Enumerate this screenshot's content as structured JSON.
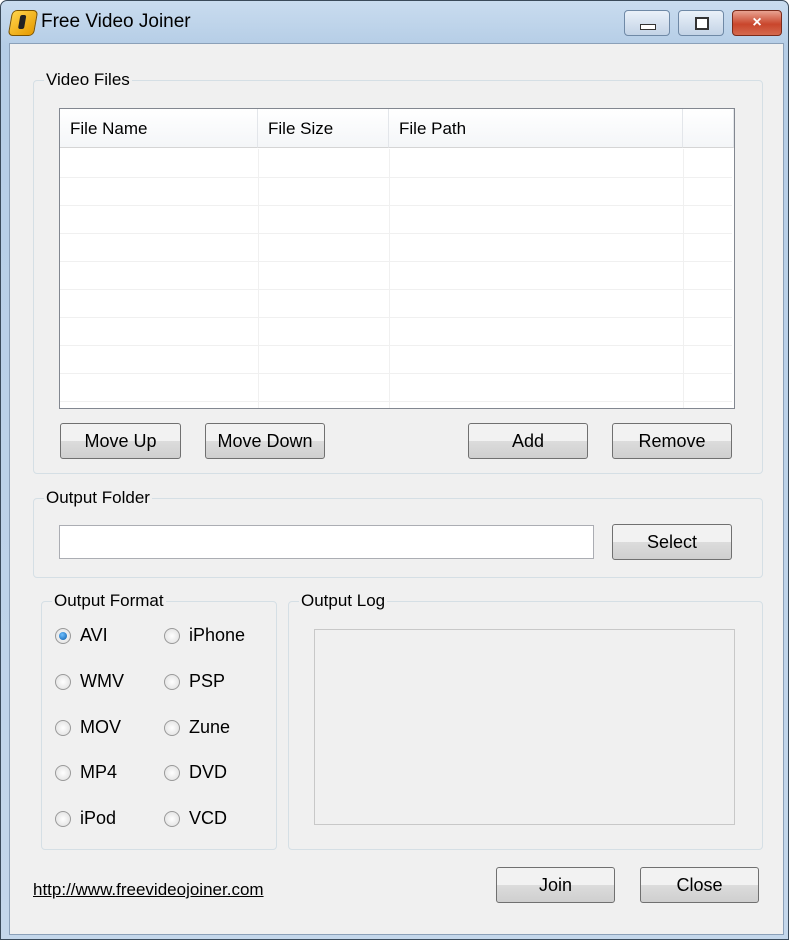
{
  "window": {
    "title": "Free Video Joiner",
    "controls": {
      "minimize": "minimize-icon",
      "maximize": "maximize-icon",
      "close": "×"
    }
  },
  "video_files": {
    "label": "Video Files",
    "columns": [
      "File Name",
      "File Size",
      "File Path",
      ""
    ],
    "rows": [],
    "buttons": {
      "move_up": "Move Up",
      "move_down": "Move Down",
      "add": "Add",
      "remove": "Remove"
    }
  },
  "output_folder": {
    "label": "Output Folder",
    "value": "",
    "select": "Select"
  },
  "output_format": {
    "label": "Output Format",
    "selected": "AVI",
    "options": [
      "AVI",
      "iPhone",
      "WMV",
      "PSP",
      "MOV",
      "Zune",
      "MP4",
      "DVD",
      "iPod",
      "VCD"
    ]
  },
  "output_log": {
    "label": "Output Log",
    "value": ""
  },
  "footer": {
    "link": "http://www.freevideojoiner.com",
    "join": "Join",
    "close": "Close"
  }
}
